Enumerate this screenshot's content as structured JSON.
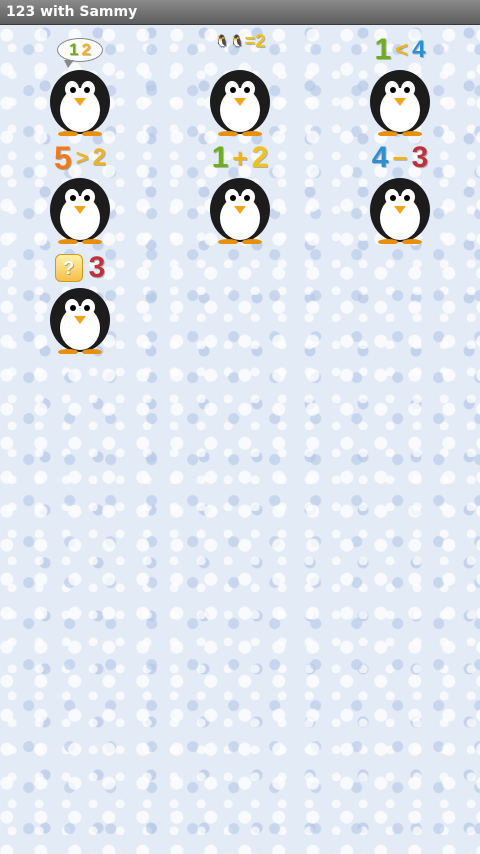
{
  "app": {
    "title": "123 with Sammy"
  },
  "tiles": [
    {
      "a": "1",
      "b": "2"
    },
    {
      "op": "=",
      "value": "2"
    },
    {
      "a": "1",
      "op": "<",
      "b": "4"
    },
    {
      "a": "5",
      "op": ">",
      "b": "2"
    },
    {
      "a": "1",
      "op": "+",
      "b": "2"
    },
    {
      "a": "4",
      "op": "−",
      "b": "3"
    },
    {
      "icon": "question-icon",
      "glyph": "?",
      "value": "3"
    }
  ]
}
